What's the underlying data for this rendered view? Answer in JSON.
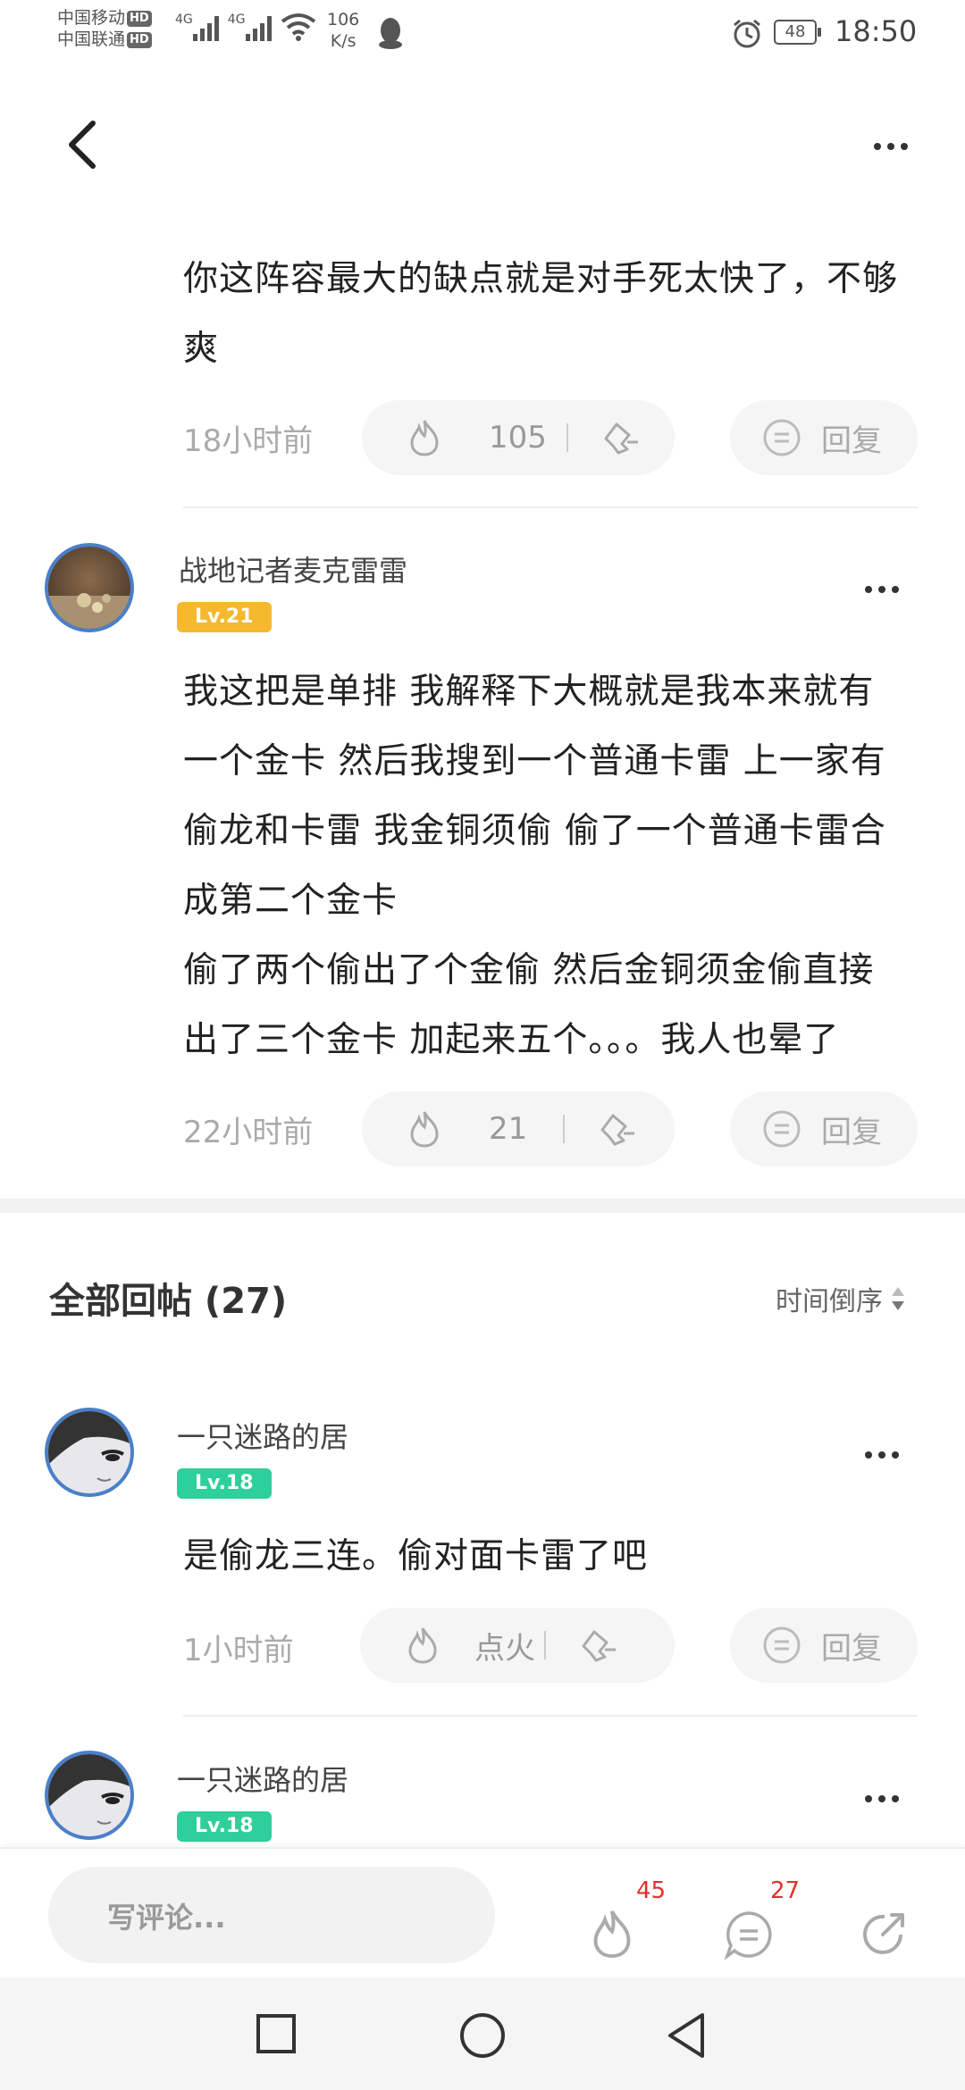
{
  "status_bar": {
    "carrier1": "中国移动",
    "carrier2": "中国联通",
    "hd": "HD",
    "net1": "4G",
    "net2": "4G",
    "speed_value": "106",
    "speed_unit": "K/s",
    "battery": "48",
    "time": "18:50"
  },
  "top_comment": {
    "text": "你这阵容最大的缺点就是对手死太快了，不够爽",
    "time": "18小时前",
    "fire_count": "105",
    "reply_label": "回复"
  },
  "comment2": {
    "username": "战地记者麦克雷雷",
    "level": "Lv.21",
    "level_color": "#f5b82e",
    "text_line1": "我这把是单排 我解释下大概就是我本来就有",
    "text_line2": "一个金卡 然后我搜到一个普通卡雷 上一家有",
    "text_line3": "偷龙和卡雷 我金铜须偷 偷了一个普通卡雷合",
    "text_line4": "成第二个金卡",
    "text_line5": "偷了两个偷出了个金偷 然后金铜须金偷直接",
    "text_line6": "出了三个金卡 加起来五个。。。我人也晕了",
    "time": "22小时前",
    "fire_count": "21",
    "reply_label": "回复"
  },
  "all_replies": {
    "title": "全部回帖 (27)",
    "sort_label": "时间倒序"
  },
  "reply1": {
    "username": "一只迷路的居",
    "level": "Lv.18",
    "level_color": "#2ecf9a",
    "text": "是偷龙三连。偷对面卡雷了吧",
    "time": "1小时前",
    "fire_label": "点火",
    "reply_label": "回复"
  },
  "reply2": {
    "username": "一只迷路的居",
    "level": "Lv.18",
    "level_color": "#2ecf9a"
  },
  "bottom_bar": {
    "comment_placeholder": "写评论...",
    "fire_badge": "45",
    "comment_badge": "27",
    "badge_color": "#e0312c"
  },
  "icons": [
    "back-icon",
    "more-icon",
    "fire-icon",
    "thumb-down-icon",
    "reply-icon",
    "sort-icon",
    "share-icon",
    "nav-square-icon",
    "nav-circle-icon",
    "nav-back-triangle-icon"
  ]
}
